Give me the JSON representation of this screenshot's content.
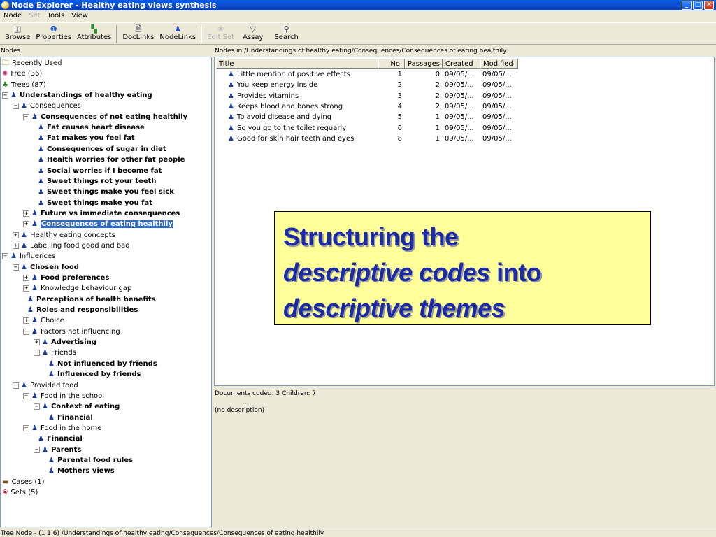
{
  "window": {
    "title": "Node Explorer - Healthy eating views synthesis"
  },
  "menu": [
    "Node",
    "Set",
    "Tools",
    "View"
  ],
  "toolbar": {
    "buttons": [
      {
        "label": "Browse",
        "icon": "browse-icon"
      },
      {
        "label": "Properties",
        "icon": "info-icon"
      },
      {
        "label": "Attributes",
        "icon": "attributes-icon"
      },
      {
        "label": "DocLinks",
        "icon": "doclinks-icon"
      },
      {
        "label": "NodeLinks",
        "icon": "nodelinks-icon"
      },
      {
        "label": "Edit Set",
        "icon": "edit-set-icon",
        "disabled": true
      },
      {
        "label": "Assay",
        "icon": "filter-icon"
      },
      {
        "label": "Search",
        "icon": "search-icon"
      }
    ]
  },
  "left": {
    "header": "Nodes",
    "tree": [
      {
        "label": "Recently Used",
        "icon": "folder-icon"
      },
      {
        "label": "Free (36)",
        "icon": "free-nodes-icon"
      },
      {
        "label": "Trees (87)",
        "icon": "trees-icon"
      },
      {
        "label": "Understandings of healthy eating",
        "bold": true
      },
      {
        "label": "Consequences"
      },
      {
        "label": "Consequences of not eating healthily",
        "bold": true
      },
      {
        "label": "Fat causes heart disease",
        "bold": true
      },
      {
        "label": "Fat makes you feel fat",
        "bold": true
      },
      {
        "label": "Consequences of sugar in diet",
        "bold": true
      },
      {
        "label": "Health worries for other fat people",
        "bold": true
      },
      {
        "label": "Social worries if I become fat",
        "bold": true
      },
      {
        "label": "Sweet things rot your teeth",
        "bold": true
      },
      {
        "label": "Sweet things make you feel sick",
        "bold": true
      },
      {
        "label": "Sweet things make you fat",
        "bold": true
      },
      {
        "label": "Future vs immediate consequences",
        "bold": true
      },
      {
        "label": "Consequences of eating healthily",
        "bold": true,
        "selected": true
      },
      {
        "label": "Healthy eating concepts"
      },
      {
        "label": "Labelling food good and bad"
      },
      {
        "label": "Influences"
      },
      {
        "label": "Chosen food",
        "bold": true
      },
      {
        "label": "Food preferences",
        "bold": true
      },
      {
        "label": "Knowledge behaviour gap"
      },
      {
        "label": "Perceptions of health benefits",
        "bold": true
      },
      {
        "label": "Roles and responsibilities",
        "bold": true
      },
      {
        "label": "Choice"
      },
      {
        "label": "Factors not influencing"
      },
      {
        "label": "Advertising",
        "bold": true
      },
      {
        "label": "Friends"
      },
      {
        "label": "Not influenced by friends",
        "bold": true
      },
      {
        "label": "Influenced by friends",
        "bold": true
      },
      {
        "label": "Provided food"
      },
      {
        "label": "Food in the school"
      },
      {
        "label": "Context of eating",
        "bold": true
      },
      {
        "label": "Financial",
        "bold": true
      },
      {
        "label": "Food in the home"
      },
      {
        "label": "Financial",
        "bold": true
      },
      {
        "label": "Parents",
        "bold": true
      },
      {
        "label": "Parental food rules",
        "bold": true
      },
      {
        "label": "Mothers views",
        "bold": true
      },
      {
        "label": "Cases (1)",
        "icon": "cases-icon"
      },
      {
        "label": "Sets (5)",
        "icon": "sets-icon"
      }
    ]
  },
  "right": {
    "header": "Nodes in /Understandings of healthy eating/Consequences/Consequences of eating healthily",
    "columns": [
      "Title",
      "No.",
      "Passages",
      "Created",
      "Modified"
    ],
    "rows": [
      {
        "title": "Little mention of positive effects",
        "no": "1",
        "passages": "0",
        "created": "09/05/...",
        "modified": "09/05/..."
      },
      {
        "title": "You keep energy inside",
        "no": "2",
        "passages": "2",
        "created": "09/05/...",
        "modified": "09/05/..."
      },
      {
        "title": "Provides vitamins",
        "no": "3",
        "passages": "2",
        "created": "09/05/...",
        "modified": "09/05/..."
      },
      {
        "title": "Keeps blood and bones strong",
        "no": "4",
        "passages": "2",
        "created": "09/05/...",
        "modified": "09/05/..."
      },
      {
        "title": "To avoid disease and dying",
        "no": "5",
        "passages": "1",
        "created": "09/05/...",
        "modified": "09/05/..."
      },
      {
        "title": "So you go to the toilet reguarly",
        "no": "6",
        "passages": "1",
        "created": "09/05/...",
        "modified": "09/05/..."
      },
      {
        "title": "Good for skin hair teeth and eyes",
        "no": "8",
        "passages": "1",
        "created": "09/05/...",
        "modified": "09/05/..."
      }
    ]
  },
  "callout": {
    "l1": "Structuring the",
    "l2_it": "descriptive codes",
    "l2_rest": " into",
    "l3_it": "descriptive themes"
  },
  "details": {
    "summary": "Documents coded: 3 Children: 7",
    "description": "(no description)"
  },
  "status": "Tree Node - (1 1 6) /Understandings of healthy eating/Consequences/Consequences of eating healthily",
  "colors": {
    "title_bar": "#0c49c8",
    "selection": "#316ac5",
    "callout_bg": "#ffff99",
    "callout_text": "#1a2aa8"
  }
}
